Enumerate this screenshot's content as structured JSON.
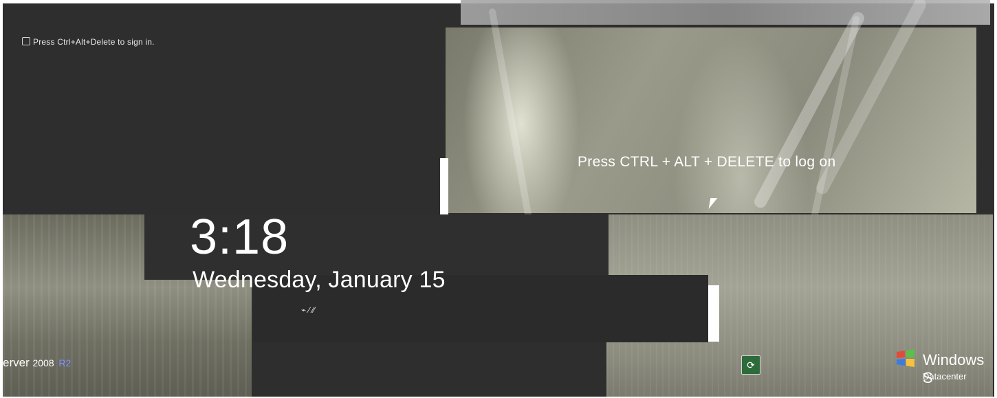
{
  "screen": {
    "login_hint_small": "Press Ctrl+Alt+Delete to sign in.",
    "press_msg": "Press CTRL + ALT + DELETE to log on",
    "time": "3:18",
    "date": "Wednesday, January 15",
    "status_glyphs": "⌁ ∕ ∕∕",
    "server_label_main": "erver",
    "server_label_year": "2008",
    "server_label_r2": "R2",
    "windows_brand": "Windows S",
    "windows_edition": "Datacenter",
    "ease_access_icon": "ease-of-access-icon",
    "colors": {
      "r2_blue": "#7f92ff",
      "access_green": "#2d6b3a"
    }
  }
}
